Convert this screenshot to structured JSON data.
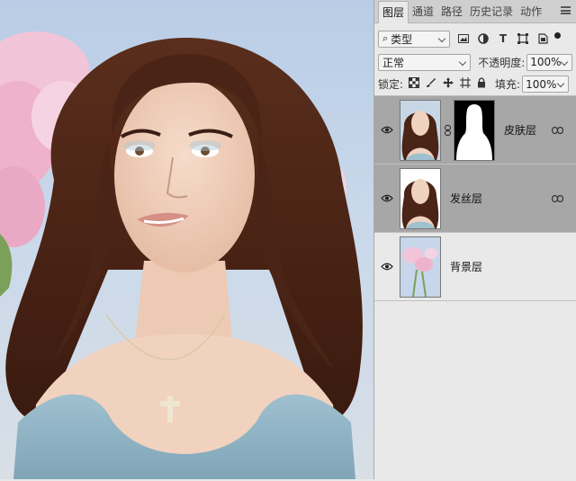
{
  "panel": {
    "tabs": [
      {
        "label": "图层",
        "active": true
      },
      {
        "label": "通道",
        "active": false
      },
      {
        "label": "路径",
        "active": false
      },
      {
        "label": "历史记录",
        "active": false
      },
      {
        "label": "动作",
        "active": false
      }
    ],
    "filter": {
      "icon": "search-icon",
      "value": "类型"
    },
    "filter_icons": [
      "image-filter-icon",
      "adjustment-filter-icon",
      "text-filter-icon",
      "shape-filter-icon",
      "smart-object-filter-icon"
    ],
    "blend_mode": "正常",
    "opacity_label": "不透明度:",
    "opacity_value": "100%",
    "lock_label": "锁定:",
    "lock_icons": [
      "lock-transparent-icon",
      "lock-paint-icon",
      "lock-position-icon",
      "lock-artboard-icon",
      "lock-all-icon"
    ],
    "fill_label": "填充:",
    "fill_value": "100%"
  },
  "layers": [
    {
      "name": "皮肤层",
      "visible": true,
      "selected": true,
      "has_mask": true,
      "linked": true,
      "thumb": "portrait"
    },
    {
      "name": "发丝层",
      "visible": true,
      "selected": true,
      "has_mask": false,
      "linked": true,
      "thumb": "portrait"
    },
    {
      "name": "背景层",
      "visible": true,
      "selected": false,
      "has_mask": false,
      "linked": false,
      "thumb": "flowers"
    }
  ],
  "colors": {
    "selected_layer_bg": "#a7a7a7",
    "panel_bg": "#e9e9e9",
    "annotation_arrow": "#d42020"
  }
}
